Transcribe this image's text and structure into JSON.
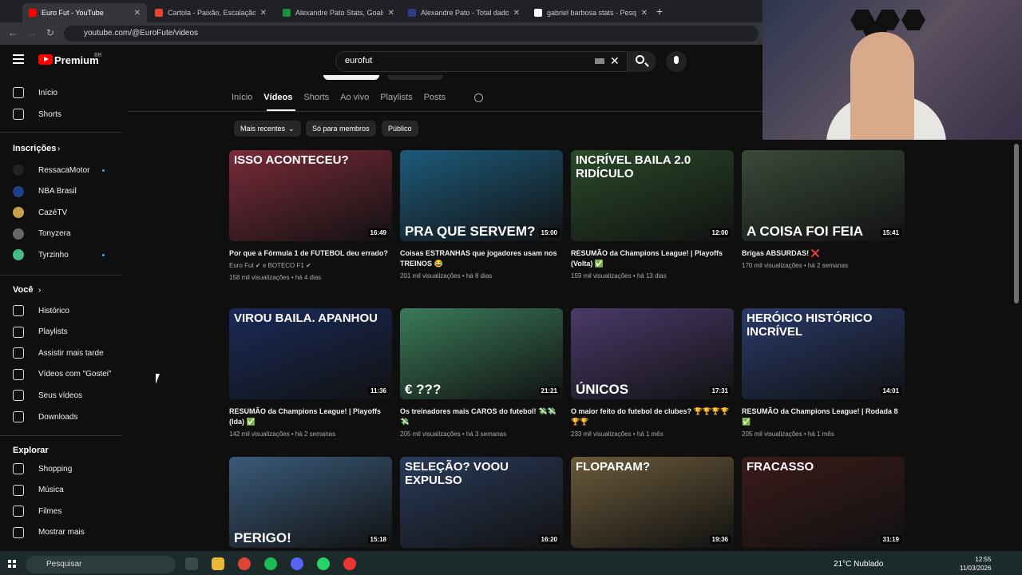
{
  "browser": {
    "tabs": [
      {
        "label": "Euro Fut - YouTube",
        "active": true,
        "color": "#ff0000"
      },
      {
        "label": "Cartola - Paixão, Escalação, Zoa...",
        "active": false,
        "color": "#e5432e"
      },
      {
        "label": "Alexandre Pato Stats, Goals, Re...",
        "active": false,
        "color": "#1d8f3a"
      },
      {
        "label": "Alexandre Pato - Total dados d...",
        "active": false,
        "color": "#2d3e8f"
      },
      {
        "label": "gabriel barbosa stats - Pesquisa...",
        "active": false,
        "color": "#ffffff"
      }
    ],
    "url": "youtube.com/@EuroFute/videos"
  },
  "youtube": {
    "logo": "Premium",
    "country": "BR",
    "search_value": "eurofut"
  },
  "sidebar": {
    "main": [
      {
        "label": "Início",
        "icon": "home-icon"
      },
      {
        "label": "Shorts",
        "icon": "shorts-icon"
      }
    ],
    "subs_title": "Inscrições",
    "subs": [
      {
        "label": "RessacaMotor",
        "color": "#222",
        "dot": true
      },
      {
        "label": "NBA Brasil",
        "color": "#1d428a",
        "dot": false
      },
      {
        "label": "CazéTV",
        "color": "#c9a14a",
        "dot": false
      },
      {
        "label": "Tonyzera",
        "color": "#666",
        "dot": false
      },
      {
        "label": "Tyrzinho",
        "color": "#4b8",
        "dot": true
      }
    ],
    "you_title": "Você",
    "you": [
      {
        "label": "Histórico",
        "icon": "history-icon"
      },
      {
        "label": "Playlists",
        "icon": "playlists-icon"
      },
      {
        "label": "Assistir mais tarde",
        "icon": "watch-later-icon"
      },
      {
        "label": "Vídeos com \"Gostei\"",
        "icon": "like-icon"
      },
      {
        "label": "Seus vídeos",
        "icon": "your-videos-icon"
      },
      {
        "label": "Downloads",
        "icon": "download-icon"
      }
    ],
    "explore_title": "Explorar",
    "explore": [
      {
        "label": "Shopping",
        "icon": "shopping-icon"
      },
      {
        "label": "Música",
        "icon": "music-icon"
      },
      {
        "label": "Filmes",
        "icon": "movies-icon"
      },
      {
        "label": "Mostrar mais",
        "icon": "chevron-down-icon"
      }
    ]
  },
  "channel": {
    "tabs": [
      "Início",
      "Vídeos",
      "Shorts",
      "Ao vivo",
      "Playlists",
      "Posts"
    ],
    "selected_tab": "Vídeos",
    "chips": [
      "Mais recentes",
      "Só para membros",
      "Público"
    ]
  },
  "videos": [
    {
      "thumb_top": "ISSO ACONTECEU?",
      "thumb_bottom": "",
      "bg": "#7a2a3a",
      "duration": "16:49",
      "title": "Por que a Fórmula 1 de FUTEBOL deu errado?",
      "meta1": "Euro Fut ✔ e BOTECO F1 ✔",
      "meta2": "158 mil visualizações • há 4 dias"
    },
    {
      "thumb_top": "",
      "thumb_bottom": "PRA QUE SERVEM?",
      "bg": "#1d5a7a",
      "duration": "15:00",
      "title": "Coisas ESTRANHAS que jogadores usam nos TREINOS 😂",
      "meta1": "",
      "meta2": "201 mil visualizações • há 8 dias"
    },
    {
      "thumb_top": "INCRÍVEL BAILA 2.0 RIDÍCULO",
      "thumb_bottom": "",
      "bg": "#2a4a2a",
      "duration": "12:00",
      "title": "RESUMÃO da Champions League! | Playoffs (Volta) ✅",
      "meta1": "",
      "meta2": "159 mil visualizações • há 13 dias"
    },
    {
      "thumb_top": "",
      "thumb_bottom": "A COISA FOI FEIA",
      "bg": "#3a4a3a",
      "duration": "15:41",
      "title": "Brigas ABSURDAS! ❌",
      "meta1": "",
      "meta2": "170 mil visualizações • há 2 semanas"
    },
    {
      "thumb_top": "VIROU BAILA. APANHOU",
      "thumb_bottom": "",
      "bg": "#1a2a5a",
      "duration": "11:36",
      "title": "RESUMÃO da Champions League! | Playoffs (Ida) ✅",
      "meta1": "",
      "meta2": "142 mil visualizações • há 2 semanas"
    },
    {
      "thumb_top": "",
      "thumb_bottom": "€ ???",
      "bg": "#3a7a5a",
      "duration": "21:21",
      "title": "Os treinadores mais CAROS do futebol! 💸💸💸",
      "meta1": "",
      "meta2": "205 mil visualizações • há 3 semanas"
    },
    {
      "thumb_top": "",
      "thumb_bottom": "ÚNICOS",
      "bg": "#4a3a6a",
      "duration": "17:31",
      "title": "O maior feito do futebol de clubes? 🏆🏆🏆🏆🏆🏆",
      "meta1": "",
      "meta2": "233 mil visualizações • há 1 mês"
    },
    {
      "thumb_top": "HERÓICO HISTÓRICO INCRÍVEL",
      "thumb_bottom": "",
      "bg": "#2a3a6a",
      "duration": "14:01",
      "title": "RESUMÃO da Champions League! | Rodada 8 ✅",
      "meta1": "",
      "meta2": "205 mil visualizações • há 1 mês"
    },
    {
      "thumb_top": "",
      "thumb_bottom": "PERIGO!",
      "bg": "#3a5a7a",
      "duration": "15:18",
      "title": "",
      "meta1": "",
      "meta2": ""
    },
    {
      "thumb_top": "SELEÇÃO? VOOU EXPULSO",
      "thumb_bottom": "",
      "bg": "#2a3a5a",
      "duration": "16:20",
      "title": "",
      "meta1": "",
      "meta2": ""
    },
    {
      "thumb_top": "FLOPARAM?",
      "thumb_bottom": "",
      "bg": "#6a5a3a",
      "duration": "19:36",
      "title": "",
      "meta1": "",
      "meta2": ""
    },
    {
      "thumb_top": "FRACASSO",
      "thumb_bottom": "",
      "bg": "#3a1a1a",
      "duration": "31:19",
      "title": "",
      "meta1": "",
      "meta2": ""
    }
  ],
  "taskbar": {
    "search": "Pesquisar",
    "weather": "21°C  Nublado",
    "time": "12:55",
    "date": "11/03/2026"
  }
}
